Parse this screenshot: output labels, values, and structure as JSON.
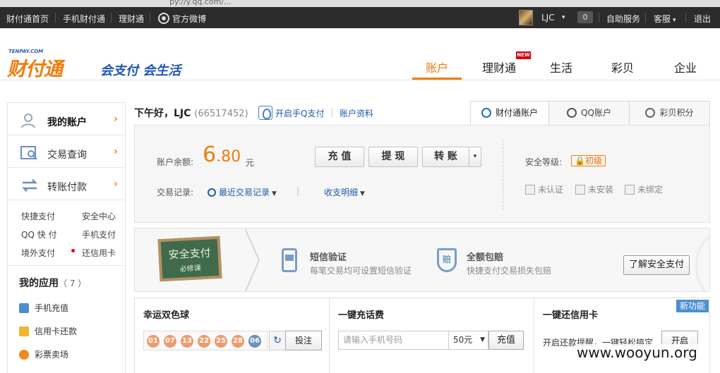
{
  "browser": {
    "url_fragment": "py://y.qq.com/..."
  },
  "topbar": {
    "links": [
      "财付通首页",
      "手机财付通",
      "理财通",
      "官方微博"
    ],
    "username": "LJC",
    "count": "0",
    "right_links": [
      "自助服务",
      "客服",
      "退出"
    ]
  },
  "logo": {
    "small": "TENPAY.COM",
    "main": "财付通",
    "slogan": "会支付 会生活"
  },
  "nav": {
    "items": [
      "账户",
      "理财通",
      "生活",
      "彩贝",
      "企业"
    ],
    "new_badge": "NEW"
  },
  "sidebar": {
    "main": [
      "我的账户",
      "交易查询",
      "转账付款"
    ],
    "quick_links": [
      "快捷支付",
      "安全中心",
      "QQ 快 付",
      "手机支付",
      "境外支付",
      "还信用卡"
    ],
    "apps_title": "我的应用",
    "apps_count": "（ 7 ）",
    "apps": [
      "手机充值",
      "信用卡还款",
      "彩票卖场"
    ]
  },
  "account": {
    "greeting": "下午好，LJC",
    "uid": "(66517452)",
    "qq_pay_link": "开启手Q支付",
    "profile_link": "账户资料",
    "tabs": [
      "财付通账户",
      "QQ账户",
      "彩贝积分"
    ],
    "balance_label": "账户余额:",
    "balance_int": "6",
    "balance_dec": ".80",
    "currency": "元",
    "buttons": [
      "充 值",
      "提 现",
      "转 账"
    ],
    "tx_label": "交易记录:",
    "recent_tx": "最近交易记录",
    "detail_link": "收支明细",
    "security_label": "安全等级:",
    "security_level": "初级",
    "security_items": [
      "未认证",
      "未安装",
      "未绑定"
    ]
  },
  "banner": {
    "chalk_title": "安全支付",
    "chalk_sub": "必修课",
    "items": [
      {
        "title": "短信验证",
        "sub": "每笔交易均可设置短信验证"
      },
      {
        "title": "全额包赔",
        "sub": "快捷支付交易损失包赔"
      }
    ],
    "shield_text": "赔",
    "button": "了解安全支付"
  },
  "widgets": {
    "lottery_title": "幸运双色球",
    "balls": [
      "01",
      "07",
      "13",
      "22",
      "25",
      "28",
      "06"
    ],
    "refresh": "↻",
    "bet_button": "投注",
    "recharge_title": "一键充话费",
    "phone_placeholder": "请输入手机号码",
    "amount": "50元",
    "recharge_button": "充值",
    "credit_title": "一键还信用卡",
    "new_func": "新功能",
    "credit_text": "开启还款提醒，一键轻松搞定",
    "open_button": "开启"
  },
  "watermark": "www.wooyun.org"
}
